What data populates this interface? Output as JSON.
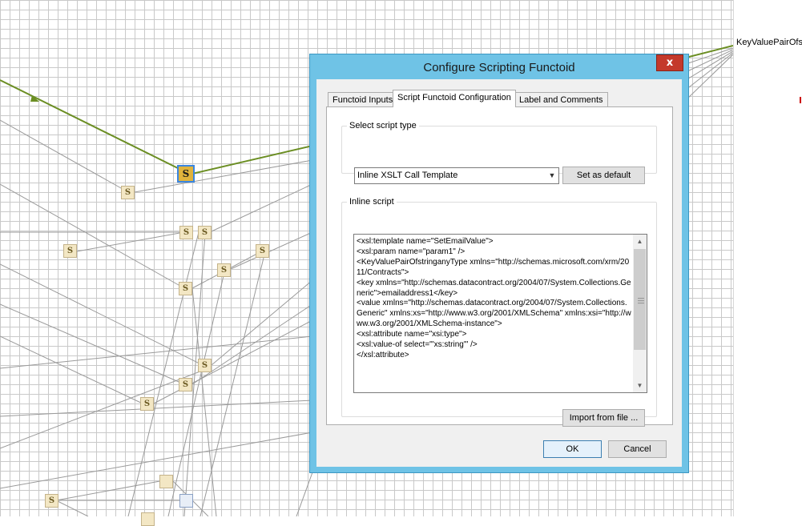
{
  "canvas": {
    "node_label": "KeyValuePairOfst",
    "functoid_glyph": "S",
    "link_color": "#6b8e23",
    "grid_color": "#c9c9c9"
  },
  "dialog": {
    "title": "Configure Scripting Functoid",
    "close_label": "x",
    "tabs": [
      {
        "label": "Functoid Inputs",
        "active": false
      },
      {
        "label": "Script Functoid Configuration",
        "active": true
      },
      {
        "label": "Label and Comments",
        "active": false
      }
    ],
    "script_type": {
      "legend": "Select script type",
      "selected": "Inline XSLT Call Template",
      "set_default_label": "Set as default"
    },
    "inline_script": {
      "legend": "Inline script",
      "text": "<xsl:template name=\"SetEmailValue\">\n<xsl:param name=\"param1\" />\n<KeyValuePairOfstringanyType xmlns=\"http://schemas.microsoft.com/xrm/2011/Contracts\">\n<key xmlns=\"http://schemas.datacontract.org/2004/07/System.Collections.Generic\">emailaddress1</key>\n<value xmlns=\"http://schemas.datacontract.org/2004/07/System.Collections.Generic\" xmlns:xs=\"http://www.w3.org/2001/XMLSchema\" xmlns:xsi=\"http://www.w3.org/2001/XMLSchema-instance\">\n<xsl:attribute name=\"xsi:type\">\n<xsl:value-of select=\"'xs:string'\" />\n</xsl:attribute>",
      "import_label": "Import from file ..."
    },
    "ok_label": "OK",
    "cancel_label": "Cancel",
    "title_bar_color": "#6fc3e6",
    "close_color": "#c4392b"
  }
}
